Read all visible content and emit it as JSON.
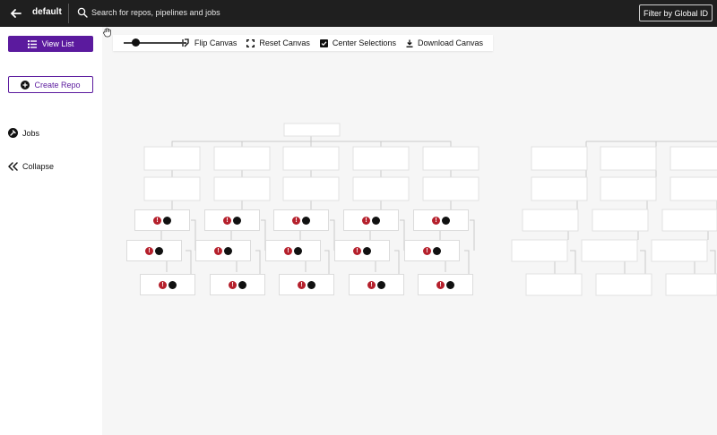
{
  "header": {
    "project": "default",
    "search_placeholder": "Search for repos, pipelines and jobs",
    "filter_label": "Filter by Global ID"
  },
  "sidebar": {
    "view_list_label": "View List",
    "create_repo_label": "Create Repo",
    "jobs_label": "Jobs",
    "collapse_label": "Collapse"
  },
  "toolbar": {
    "zoom_level": 0.15,
    "flip_label": "Flip Canvas",
    "reset_label": "Reset Canvas",
    "center_label": "Center Selections",
    "download_label": "Download Canvas"
  },
  "colors": {
    "header_bg": "#1f1f1f",
    "accent": "#5b1a9e",
    "error": "#b5202c"
  },
  "canvas": {
    "job_node_icons": [
      "error-icon",
      "job-state-icon"
    ],
    "job_node_count": 15
  }
}
